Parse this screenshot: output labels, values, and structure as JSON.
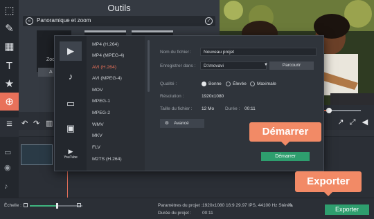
{
  "left_toolbar": {
    "items": [
      {
        "icon": "clip-icon",
        "glyph": "⬚"
      },
      {
        "icon": "magic-wand-icon",
        "glyph": "✎"
      },
      {
        "icon": "film-icon",
        "glyph": "▦"
      },
      {
        "icon": "text-icon",
        "glyph": "T"
      },
      {
        "icon": "star-icon",
        "glyph": "★"
      },
      {
        "icon": "zoom-icon",
        "glyph": "⊕"
      },
      {
        "icon": "list-icon",
        "glyph": "≡"
      }
    ],
    "active_index": 5
  },
  "outils": {
    "title": "Outils",
    "section_name": "Panoramique et zoom",
    "thumb_label": "Zoo",
    "button_label": "A"
  },
  "dialog": {
    "categories": [
      {
        "icon": "video-file-icon",
        "glyph": "▶"
      },
      {
        "icon": "audio-note-icon",
        "glyph": "♪"
      },
      {
        "icon": "device-icon",
        "glyph": "▭"
      },
      {
        "icon": "tv-icon",
        "glyph": "▣"
      },
      {
        "icon": "youtube-icon",
        "glyph": "▶",
        "text": "YouTube"
      }
    ],
    "formats": [
      "MP4 (H.264)",
      "MP4 (MPEG-4)",
      "AVI (H.264)",
      "AVI (MPEG-4)",
      "MOV",
      "MPEG-1",
      "MPEG-2",
      "WMV",
      "MKV",
      "FLV",
      "M2TS (H.264)"
    ],
    "selected_format_index": 2,
    "filename_label": "Nom du fichier :",
    "filename_value": "Nouveau projet",
    "save_in_label": "Enregistrer dans :",
    "save_in_value": "D:\\movavi",
    "browse_label": "Parcourir",
    "quality_label": "Qualité :",
    "quality_options": [
      "Bonne",
      "Élevée",
      "Maximale"
    ],
    "quality_selected": 0,
    "resolution_label": "Résolution :",
    "resolution_value": "1920x1080",
    "filesize_label": "Taille du fichier :",
    "filesize_value": "12 Mo",
    "duration_label": "Durée :",
    "duration_value": "00:11",
    "advanced_label": "Avancé",
    "start_label": "Démarrer"
  },
  "callouts": {
    "start": "Démarrer",
    "export": "Exporter"
  },
  "status": {
    "scale_label": "Échelle :",
    "project_params_label": "Paramètres du projet :",
    "project_params_value": "1920x1080 16:9 29.97 IPS, 44100 Hz Stéréo",
    "project_duration_label": "Durée du projet :",
    "project_duration_value": "00:11",
    "export_label": "Exporter"
  },
  "colors": {
    "accent": "#e8715a",
    "callout": "#f28a66",
    "action_green": "#2e9e6e"
  }
}
